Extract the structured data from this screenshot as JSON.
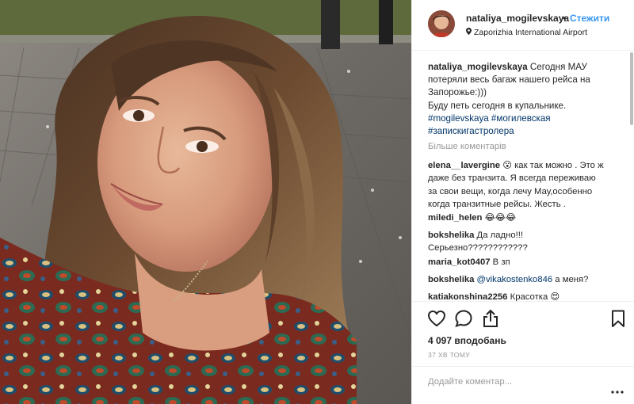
{
  "post": {
    "username": "nataliya_mogilevskaya",
    "follow_label": "Стежити",
    "separator": "•",
    "location": "Zaporizhia International Airport"
  },
  "caption": {
    "username": "nataliya_mogilevskaya",
    "line1": " Сегодня МАУ",
    "line2": "потеряли весь багаж нашего рейса на",
    "line3": "Запорожье:)))",
    "line4": "Буду петь сегодня в купальнике.",
    "tag1": "#mogilevskaya",
    "tag2": "#могилевская",
    "tag3": "#запискигастролера"
  },
  "more_comments_label": "Більше коментарів",
  "comments": [
    {
      "username": "elena__lavergine",
      "lines": [
        " 😮 как так можно . Это ж",
        "даже без транзита. Я всегда переживаю",
        "за свои вещи, когда лечу Мау,особенно",
        "когда транзитные рейсы. Жесть ."
      ]
    },
    {
      "username": "miledi_helen",
      "lines": [
        " 😂😂😂"
      ]
    },
    {
      "username": "bokshelika",
      "lines": [
        " Да ладно!!!",
        "Серьезно????????????"
      ]
    },
    {
      "username": "maria_kot0407",
      "lines": [
        " В зп"
      ]
    },
    {
      "username": "bokshelika",
      "mention": "@vikakostenko846",
      "lines": [
        " а меня?"
      ]
    },
    {
      "username": "katiakonshina2256",
      "lines": [
        " Красотка 😍"
      ]
    }
  ],
  "likes_label": "4 097 вподобань",
  "time_label": "37 ХВ ТОМУ",
  "add_comment_placeholder": "Додайте коментар...",
  "icons": {
    "like": "heart-icon",
    "comment": "comment-bubble-icon",
    "share": "share-upload-icon",
    "save": "bookmark-icon",
    "location": "location-pin-icon",
    "more": "more-dots-icon"
  },
  "colors": {
    "link": "#3897f0",
    "hashtag": "#003569",
    "muted": "#999999",
    "text": "#262626"
  }
}
